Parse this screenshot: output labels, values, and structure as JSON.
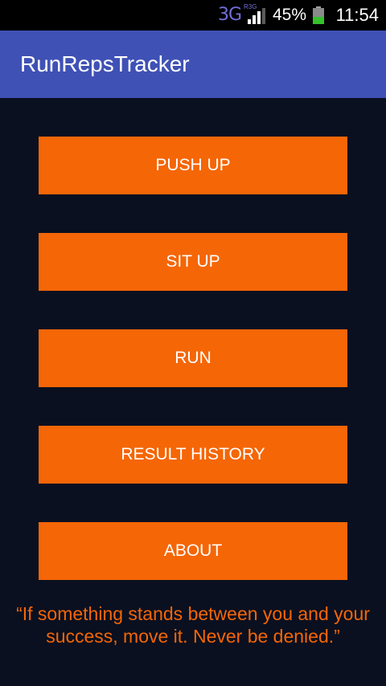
{
  "status_bar": {
    "network": "3G",
    "network_sub": "R3G",
    "battery_percent": "45%",
    "battery_level": 0.45,
    "time": "11:54"
  },
  "app_bar": {
    "title": "RunRepsTracker",
    "color": "#3f51b5"
  },
  "menu": {
    "button_color": "#f56606",
    "buttons": [
      {
        "label": "PUSH UP"
      },
      {
        "label": "SIT UP"
      },
      {
        "label": "RUN"
      },
      {
        "label": "RESULT HISTORY"
      },
      {
        "label": "ABOUT"
      }
    ]
  },
  "quote": "“If something stands between you and your success, move it. Never be denied.”"
}
